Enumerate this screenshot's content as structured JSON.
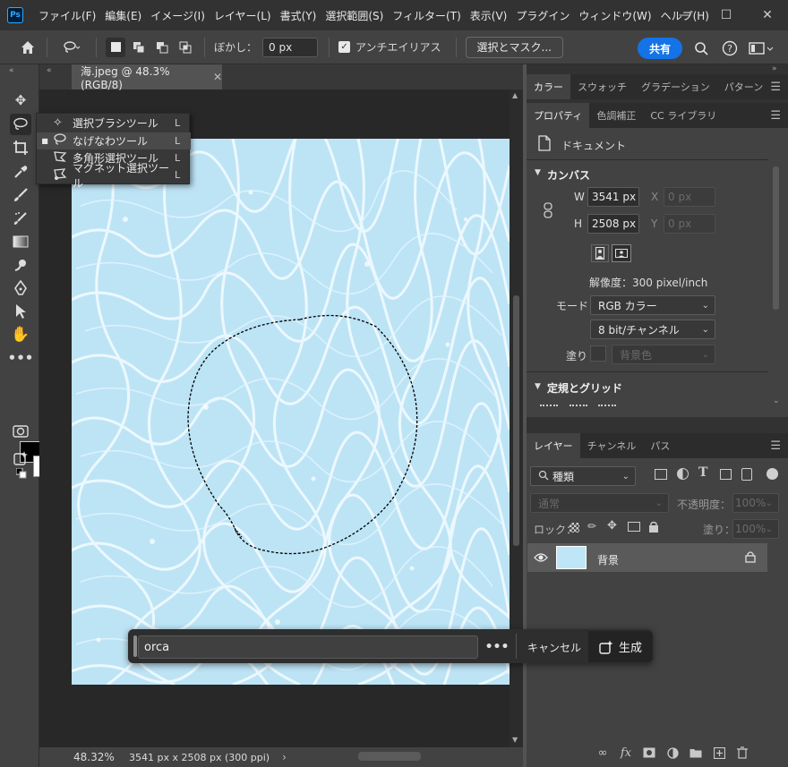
{
  "app": {
    "logo": "Ps"
  },
  "menu": [
    "ファイル(F)",
    "編集(E)",
    "イメージ(I)",
    "レイヤー(L)",
    "書式(Y)",
    "選択範囲(S)",
    "フィルター(T)",
    "表示(V)",
    "プラグイン",
    "ウィンドウ(W)",
    "ヘルプ(H)"
  ],
  "options": {
    "feather_label": "ぼかし：",
    "feather_value": "0 px",
    "antialias_label": "アンチエイリアス",
    "antialias_checked": true,
    "select_mask": "選択とマスク...",
    "share": "共有"
  },
  "flyout": {
    "items": [
      {
        "label": "選択ブラシツール",
        "key": "L",
        "icon": "brush-select-icon",
        "current": false
      },
      {
        "label": "なげなわツール",
        "key": "L",
        "icon": "lasso-icon",
        "current": true
      },
      {
        "label": "多角形選択ツール",
        "key": "L",
        "icon": "polygon-lasso-icon",
        "current": false
      },
      {
        "label": "マグネット選択ツール",
        "key": "L",
        "icon": "magnetic-lasso-icon",
        "current": false
      }
    ]
  },
  "document": {
    "tab_title": "海.jpeg @ 48.3% (RGB/8)",
    "zoom": "48.32%",
    "doc_info": "3541 px x 2508 px (300 ppi)"
  },
  "taskbar": {
    "prompt": "orca",
    "more": "•••",
    "cancel": "キャンセル",
    "generate": "生成"
  },
  "panels": {
    "top_tabs": [
      "カラー",
      "スウォッチ",
      "グラデーション",
      "パターン"
    ],
    "prop_tabs": [
      "プロパティ",
      "色調補正",
      "CC ライブラリ"
    ],
    "doc_label": "ドキュメント",
    "canvas_section": "カンバス",
    "w_label": "W",
    "w_value": "3541 px",
    "h_label": "H",
    "h_value": "2508 px",
    "x_label": "X",
    "x_value": "0 px",
    "y_label": "Y",
    "y_value": "0 px",
    "resolution": "解像度：300 pixel/inch",
    "mode_label": "モード",
    "mode_value": "RGB カラー",
    "depth_value": "8 bit/チャンネル",
    "fill_label": "塗り",
    "fill_value": "背景色",
    "rulers_section": "定規とグリッド",
    "layer_tabs": [
      "レイヤー",
      "チャンネル",
      "パス"
    ],
    "kind_label": "種類",
    "blend_mode": "通常",
    "opacity_label": "不透明度：",
    "opacity_value": "100%",
    "lock_label": "ロック：",
    "fill_pct_label": "塗り：",
    "fill_pct_value": "100%",
    "layer_name": "背景"
  },
  "colors": {
    "accent": "#1473e6",
    "canvas": "#bfe6f6"
  }
}
